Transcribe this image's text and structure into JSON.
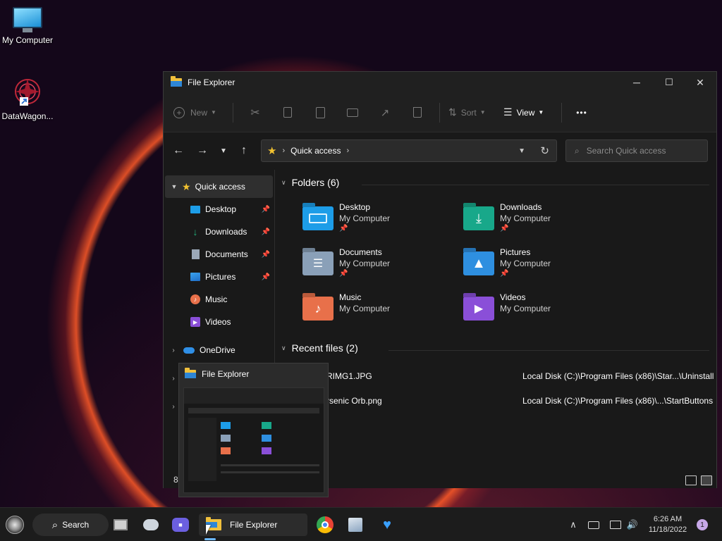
{
  "desktop": {
    "icons": [
      {
        "label": "My Computer",
        "icon": "monitor-icon"
      },
      {
        "label": "DataWagon...",
        "icon": "datawagon-icon"
      }
    ]
  },
  "window": {
    "title": "File Explorer",
    "controls": {
      "minimize": "─",
      "maximize": "☐",
      "close": "✕"
    }
  },
  "toolbar": {
    "new_label": "New",
    "sort_label": "Sort",
    "view_label": "View",
    "more": "•••"
  },
  "address": {
    "path": "Quick access",
    "search_placeholder": "Search Quick access"
  },
  "nav": {
    "quick_access": "Quick access",
    "items": [
      {
        "label": "Desktop",
        "pinned": true
      },
      {
        "label": "Downloads",
        "pinned": true
      },
      {
        "label": "Documents",
        "pinned": true
      },
      {
        "label": "Pictures",
        "pinned": true
      },
      {
        "label": "Music",
        "pinned": false
      },
      {
        "label": "Videos",
        "pinned": false
      }
    ],
    "onedrive": "OneDrive",
    "item_count": "8"
  },
  "content": {
    "folders_header": "Folders (6)",
    "folders": [
      {
        "name": "Desktop",
        "location": "My Computer",
        "pinned": true,
        "color": "#1d9de8"
      },
      {
        "name": "Downloads",
        "location": "My Computer",
        "pinned": true,
        "color": "#18a88a"
      },
      {
        "name": "Documents",
        "location": "My Computer",
        "pinned": true,
        "color": "#8aa0b8"
      },
      {
        "name": "Pictures",
        "location": "My Computer",
        "pinned": true,
        "color": "#2e8fe0"
      },
      {
        "name": "Music",
        "location": "My Computer",
        "pinned": false,
        "color": "#e8704a"
      },
      {
        "name": "Videos",
        "location": "My Computer",
        "pinned": false,
        "color": "#8a4fd8"
      }
    ],
    "recent_header": "Recent files (2)",
    "recent_files": [
      {
        "name": "RIMG1.JPG",
        "path": "Local Disk (C:)\\Program Files (x86)\\Star...\\Uninstall"
      },
      {
        "name": "rsenic Orb.png",
        "path": "Local Disk (C:)\\Program Files (x86)\\...\\StartButtons"
      }
    ]
  },
  "thumbnail": {
    "title": "File Explorer"
  },
  "taskbar": {
    "search_label": "Search",
    "active_app_label": "File Explorer",
    "time": "6:26 AM",
    "date": "11/18/2022",
    "notification_count": "1"
  }
}
